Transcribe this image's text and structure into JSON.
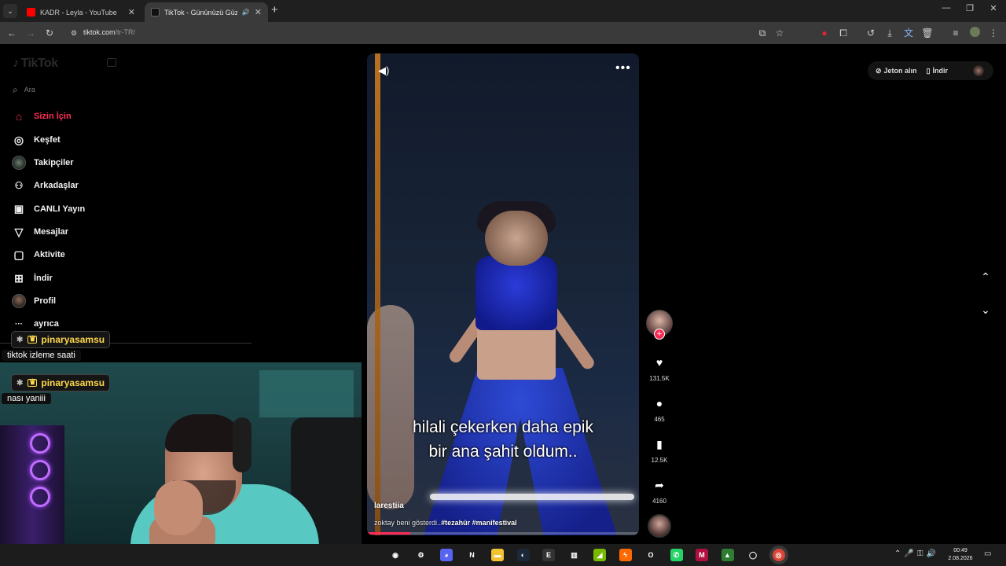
{
  "browser": {
    "tabs": [
      {
        "title": "KADR - Leyla - YouTube",
        "favicon_color": "#ff0000"
      },
      {
        "title": "TikTok - Gününüzü Güzelleş",
        "favicon_color": "#111111"
      }
    ],
    "url_host": "tiktok.com",
    "url_path": "/tr-TR/",
    "icons": {
      "tab_search": "chevron-down-icon",
      "new_tab": "+",
      "back": "←",
      "forward": "→",
      "reload": "↻",
      "minimize": "—",
      "restore": "❐",
      "close": "✕",
      "tab_close": "✕",
      "audio": "🔊",
      "menu": "⋮"
    }
  },
  "sidebar": {
    "logo": "TikTok",
    "search_placeholder": "Ara",
    "items": [
      {
        "label": "Sizin İçin",
        "icon": "⌂",
        "active": true
      },
      {
        "label": "Keşfet",
        "icon": "◎"
      },
      {
        "label": "Takipçiler",
        "icon": "avatar"
      },
      {
        "label": "Arkadaşlar",
        "icon": "👥"
      },
      {
        "label": "CANLI Yayın",
        "icon": "▣"
      },
      {
        "label": "Mesajlar",
        "icon": "▽"
      },
      {
        "label": "Aktivite",
        "icon": "▢"
      },
      {
        "label": "İndir",
        "icon": "⊞"
      },
      {
        "label": "Profil",
        "icon": "avatar"
      },
      {
        "label": "ayrıca",
        "icon": "···"
      }
    ]
  },
  "chat": [
    {
      "user": "pinaryasamsu",
      "message": "tiktok izleme saati"
    },
    {
      "user": "pinaryasamsu",
      "message": "nası yaniii"
    }
  ],
  "video": {
    "subtitle_line1": "hilali çekerken daha epik",
    "subtitle_line2": "bir ana şahit oldum..",
    "author": "larestiia",
    "caption": "zoktay beni gösterdi..",
    "hashtags": "#tezahür #manifestival",
    "progress": 0.16
  },
  "actions": {
    "likes": "131.5K",
    "comments": "465",
    "saves": "12.5K",
    "shares": "4160"
  },
  "topright": {
    "coins": "Jeton alın",
    "download": "İndir"
  },
  "taskbar": {
    "time": "00:49",
    "date": "2.08.2026",
    "apps": [
      {
        "name": "obs",
        "glyph": "◉",
        "color": "#1c1c1c"
      },
      {
        "name": "settings",
        "glyph": "⚙",
        "color": "#1c1c1c"
      },
      {
        "name": "discord",
        "glyph": "◕",
        "color": "#5865f2"
      },
      {
        "name": "netflix",
        "glyph": "N",
        "color": "#1c1c1c"
      },
      {
        "name": "files",
        "glyph": "▬",
        "color": "#f2c230"
      },
      {
        "name": "steam",
        "glyph": "◐",
        "color": "#1b2838"
      },
      {
        "name": "epic",
        "glyph": "E",
        "color": "#333333"
      },
      {
        "name": "gift",
        "glyph": "▥",
        "color": "#1c1c1c"
      },
      {
        "name": "nvidia",
        "glyph": "◢",
        "color": "#76b900"
      },
      {
        "name": "app-orange",
        "glyph": "ϟ",
        "color": "#ff6a00"
      },
      {
        "name": "opera",
        "glyph": "O",
        "color": "#1c1c1c"
      },
      {
        "name": "whatsapp",
        "glyph": "✆",
        "color": "#25d366"
      },
      {
        "name": "app-red",
        "glyph": "M",
        "color": "#b01040"
      },
      {
        "name": "app-green",
        "glyph": "▲",
        "color": "#2e7d32"
      },
      {
        "name": "app-circle",
        "glyph": "◯",
        "color": "#1c1c1c"
      },
      {
        "name": "chrome",
        "glyph": "◎",
        "color": "#db4437"
      }
    ]
  }
}
